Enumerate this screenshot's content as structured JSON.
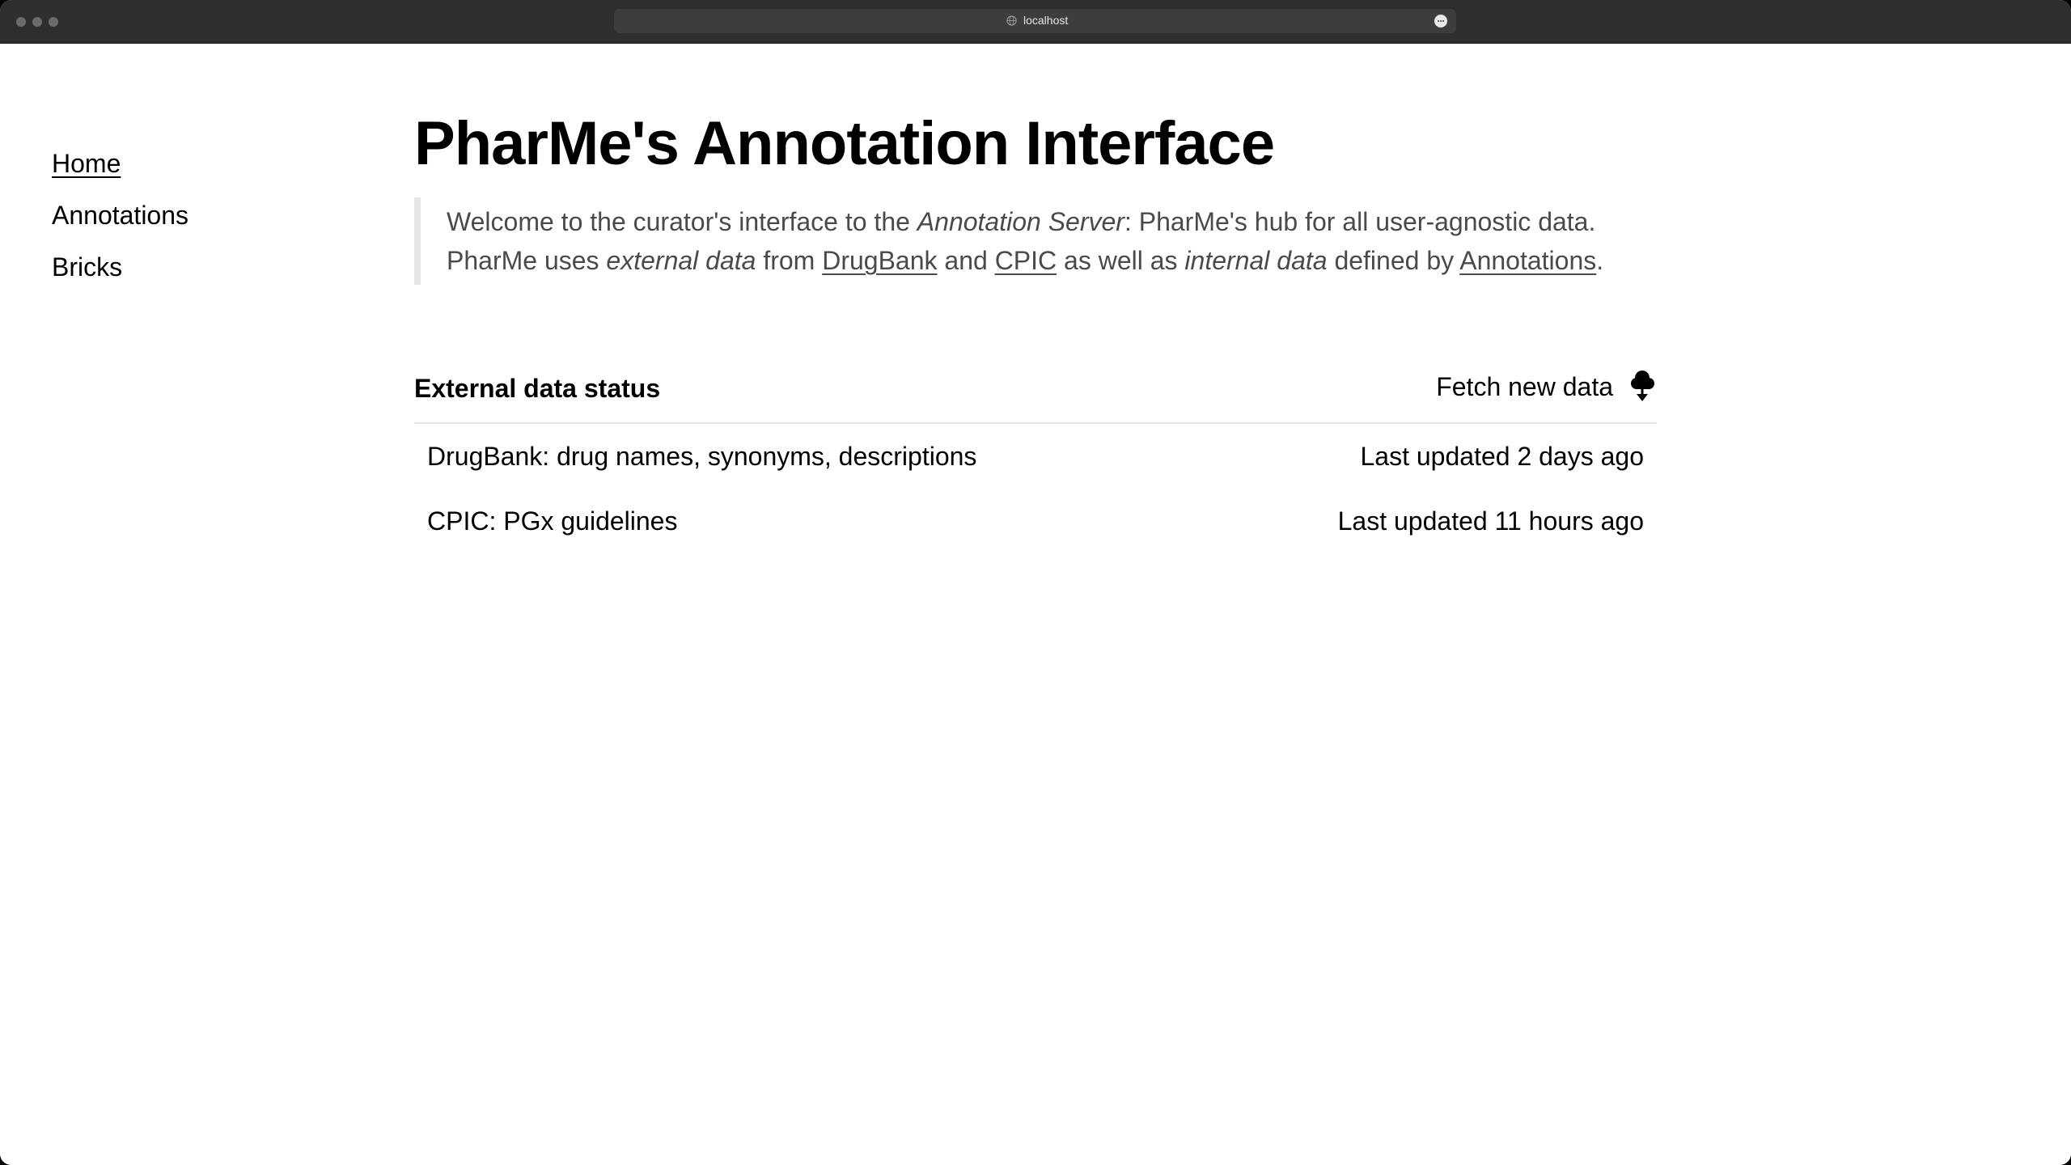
{
  "browser": {
    "url": "localhost"
  },
  "sidebar": {
    "items": [
      {
        "label": "Home",
        "active": true
      },
      {
        "label": "Annotations",
        "active": false
      },
      {
        "label": "Bricks",
        "active": false
      }
    ]
  },
  "main": {
    "title": "PharMe's Annotation Interface",
    "intro": {
      "part1": "Welcome to the curator's interface to the ",
      "annotation_server": "Annotation Server",
      "part2": ": PharMe's hub for all user-agnostic data. PharMe uses ",
      "external_data": "external data",
      "part3": " from ",
      "drugbank_link": "DrugBank",
      "part4": " and ",
      "cpic_link": "CPIC",
      "part5": " as well as ",
      "internal_data": "internal data",
      "part6": " defined by ",
      "annotations_link": "Annotations",
      "part7": "."
    },
    "status": {
      "title": "External data status",
      "fetch_label": "Fetch new data",
      "fetch_icon": "cloud-download-icon",
      "rows": [
        {
          "name": "DrugBank: drug names, synonyms, descriptions",
          "updated": "Last updated 2 days ago"
        },
        {
          "name": "CPIC: PGx guidelines",
          "updated": "Last updated 11 hours ago"
        }
      ]
    }
  }
}
